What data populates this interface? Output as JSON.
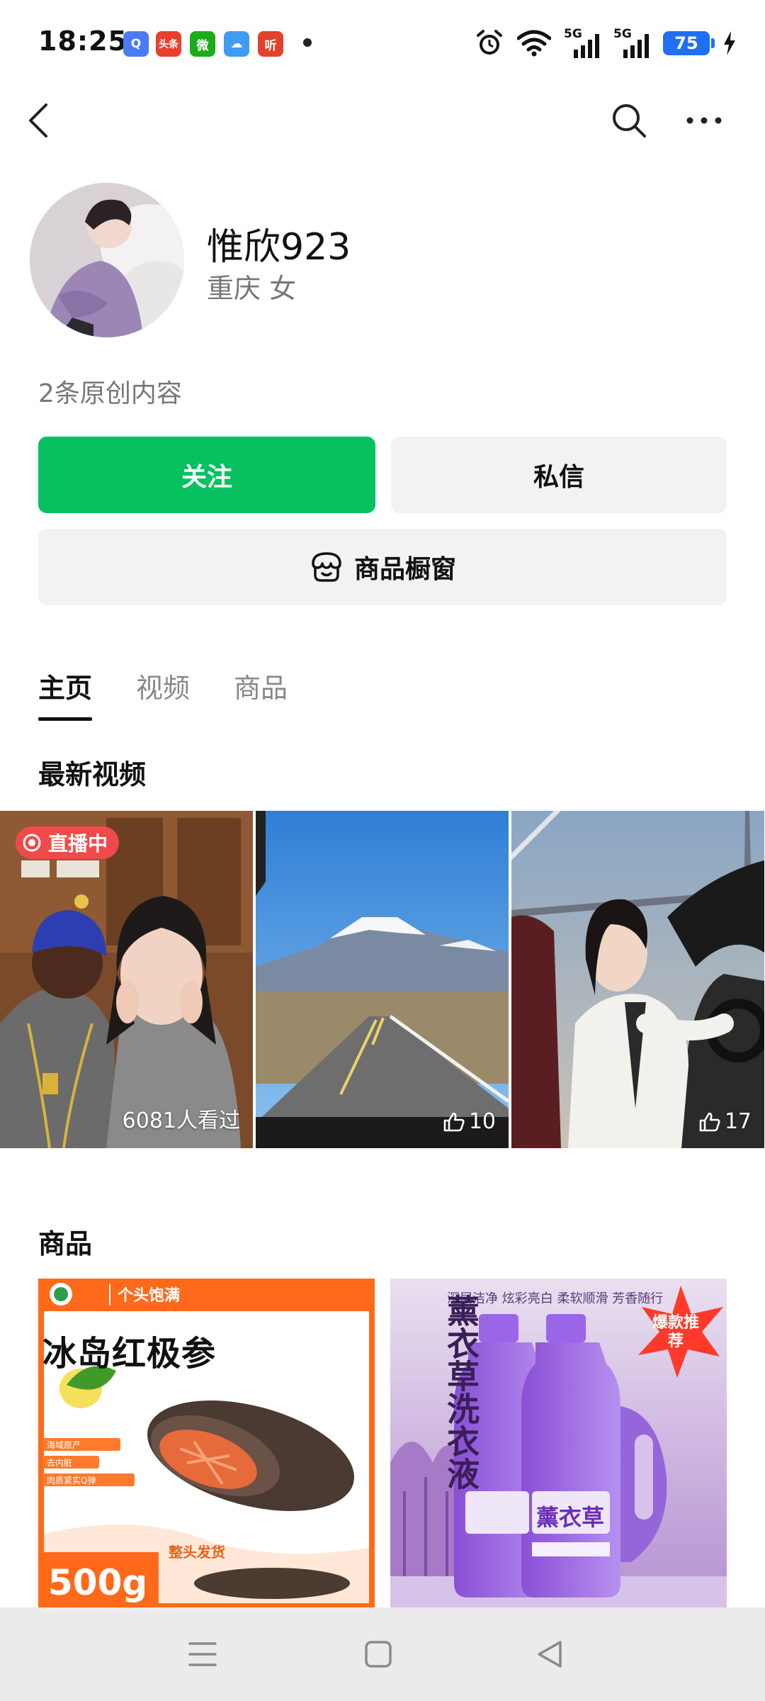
{
  "status_bar": {
    "time": "18:25",
    "notification_icons": [
      {
        "name": "browser-icon",
        "text": "Q",
        "color": "#4a7bf5"
      },
      {
        "name": "toutiao-icon",
        "text": "头条",
        "color": "#e8402f"
      },
      {
        "name": "wechat-icon",
        "text": "微",
        "color": "#1aad19"
      },
      {
        "name": "weather-icon",
        "text": "☁",
        "color": "#3f9cf0"
      },
      {
        "name": "ting-icon",
        "text": "听",
        "color": "#e3412b"
      }
    ],
    "network_1": "5G",
    "network_2": "5G",
    "battery": "75",
    "accent": "#1f6ff5"
  },
  "profile": {
    "name": "惟欣923",
    "location_gender": "重庆 女",
    "original_count": "2条原创内容"
  },
  "actions": {
    "follow_label": "关注",
    "message_label": "私信",
    "shop_label": "商品橱窗",
    "follow_color": "#07c160"
  },
  "tabs": [
    {
      "label": "主页",
      "active": true
    },
    {
      "label": "视频",
      "active": false
    },
    {
      "label": "商品",
      "active": false
    }
  ],
  "latest_videos": {
    "title": "最新视频",
    "items": [
      {
        "badge": "直播中",
        "stat": "6081人看过"
      },
      {
        "likes": "10"
      },
      {
        "likes": "17"
      }
    ]
  },
  "products": {
    "title": "商品",
    "items": [
      {
        "brand_tag": "个头饱满",
        "headline": "冰岛红极参",
        "bullets": [
          "海域原产",
          "去内脏",
          "肉质紧实Q弹"
        ],
        "weight": "500g",
        "ship_note": "整头发货"
      },
      {
        "top_line": "深层洁净 炫彩亮白 柔软顺滑 芳香随行",
        "vertical_title": "薰衣草洗衣液",
        "burst_badge": "爆款推荐",
        "bottle_label": "薰衣草"
      }
    ]
  }
}
